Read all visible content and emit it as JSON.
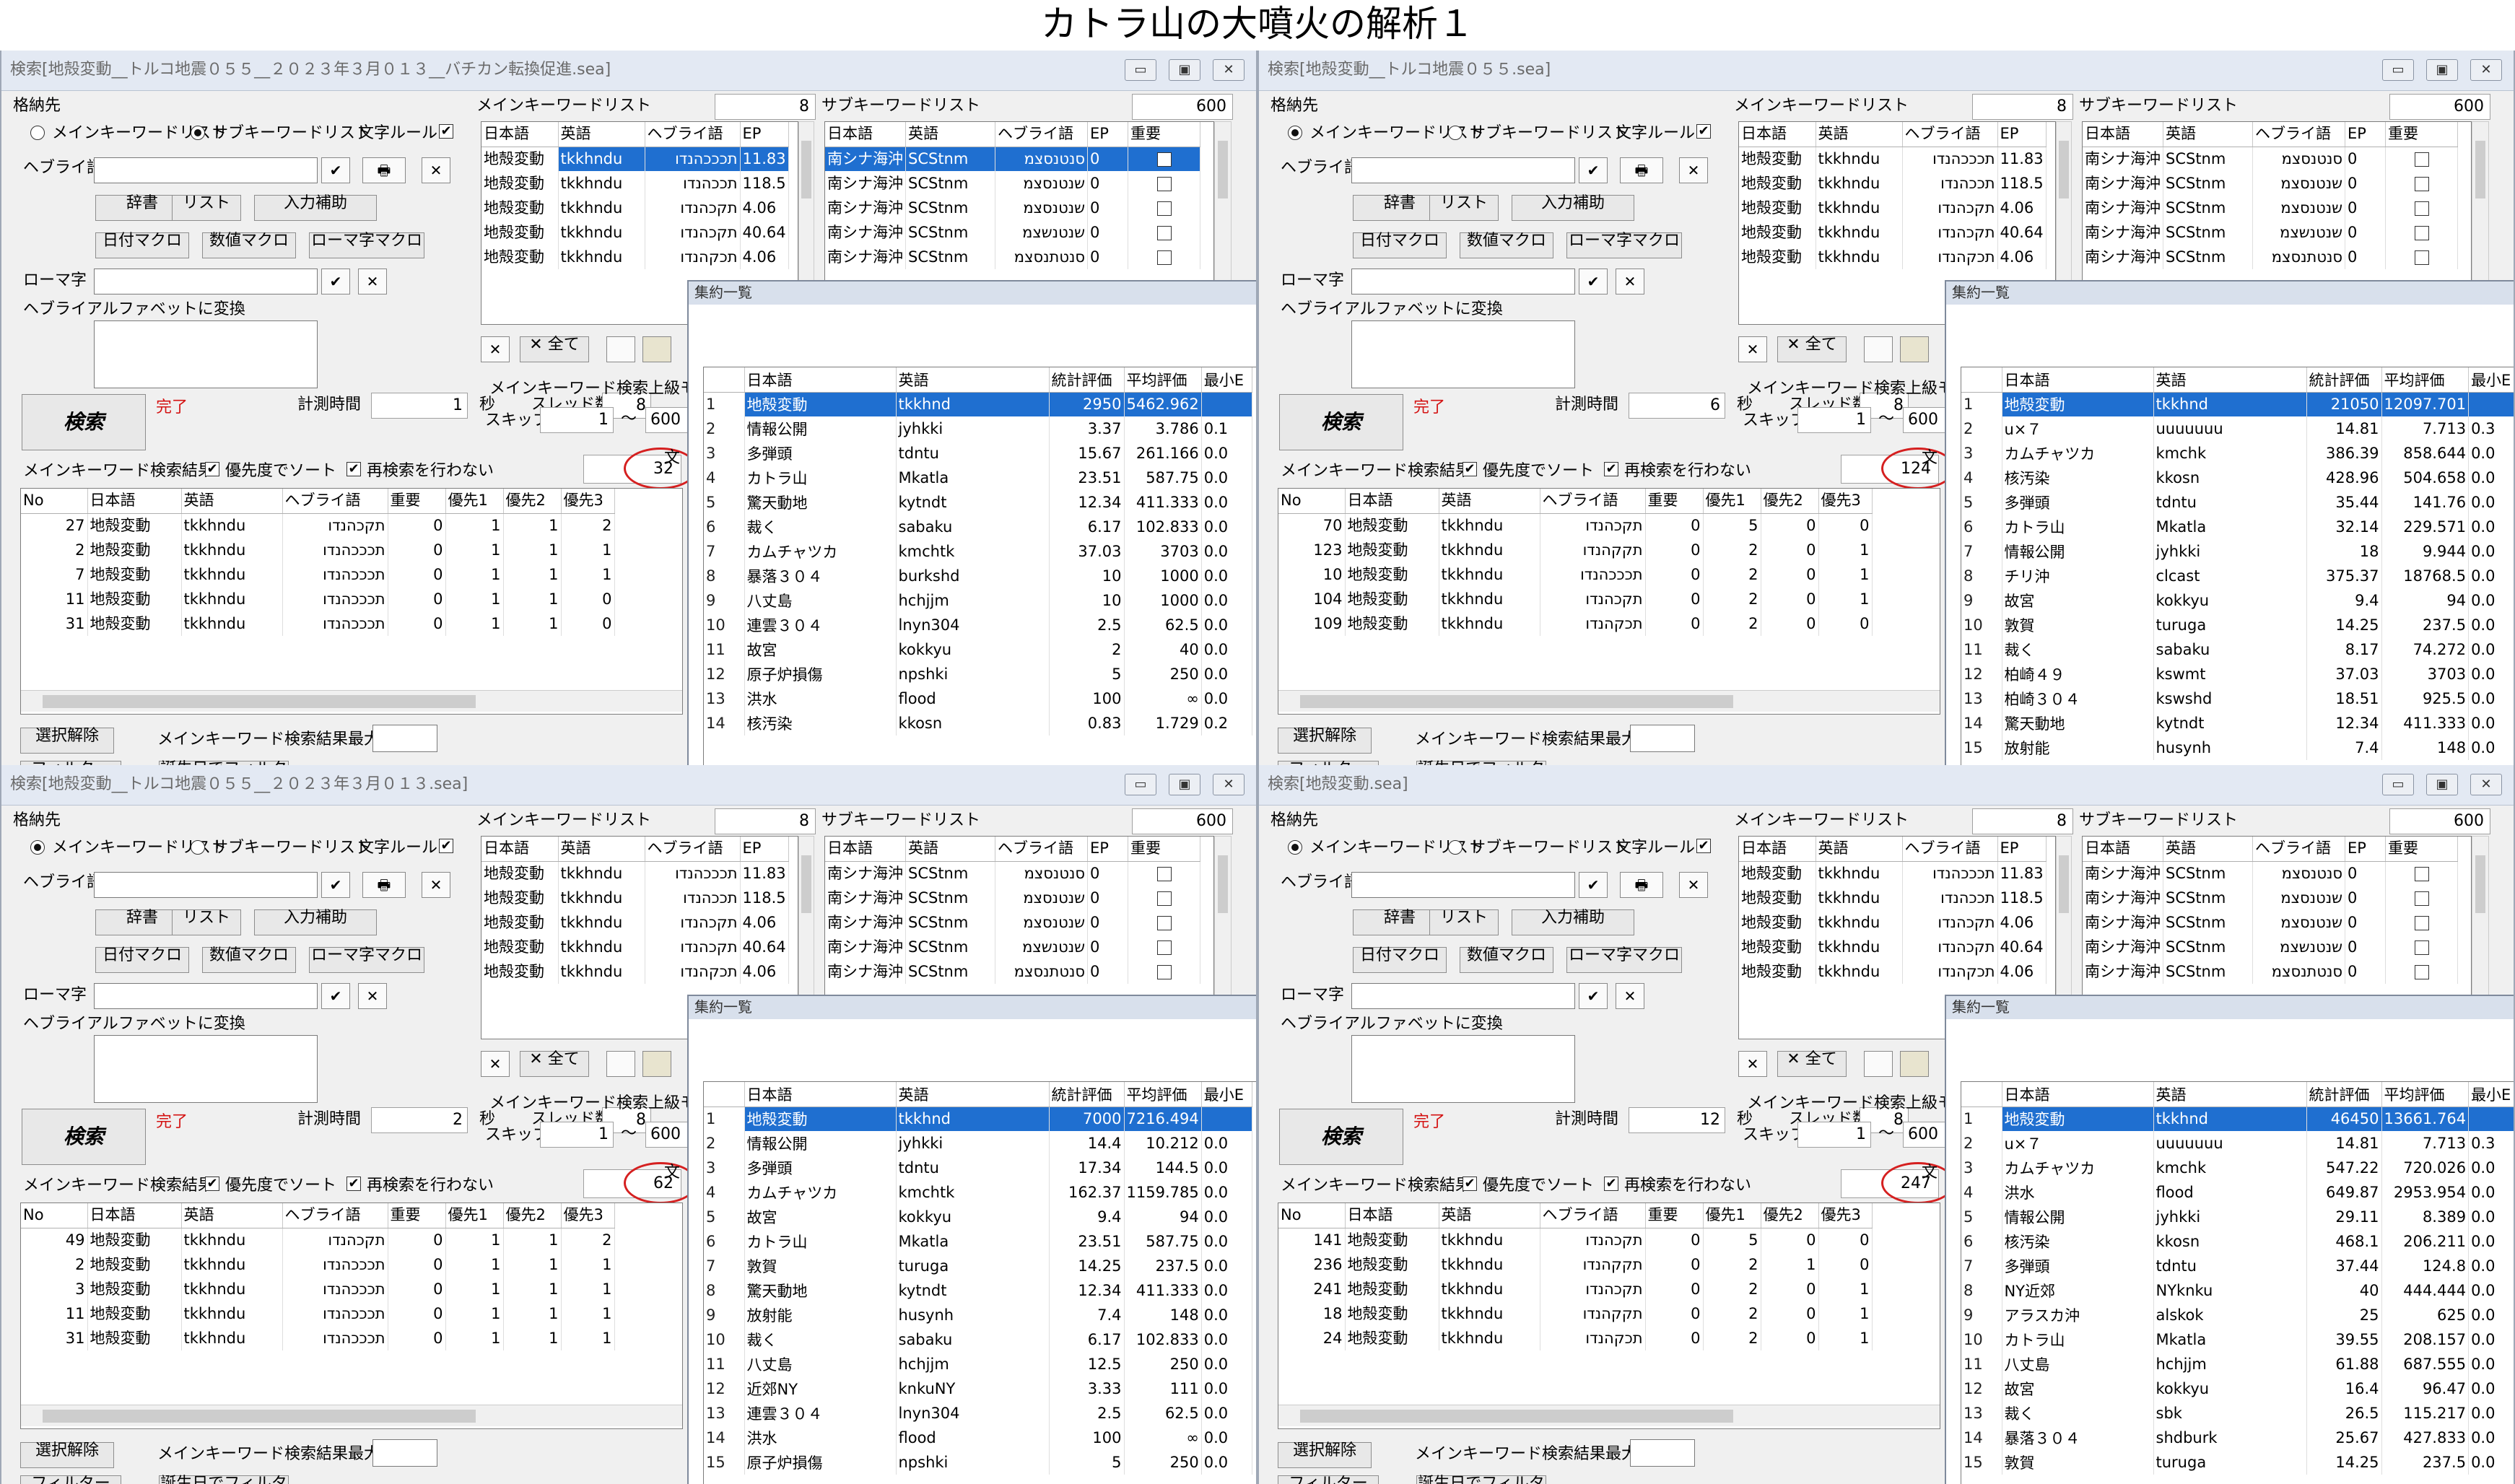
{
  "title": "カトラ山の大噴火の解析１",
  "windows": [
    {
      "title": "検索[地殻変動__トルコ地震０５５__２０２３年３月０１３__バチカン転換促進.sea]",
      "store_main": false,
      "measure_time": "1",
      "result_count": "32",
      "main_results": [
        {
          "no": "27",
          "ja": "地殻変動",
          "en": "tkkhndu",
          "he": "תקכהנדו",
          "imp": "0",
          "p1": "1",
          "p2": "1",
          "p3": "2"
        },
        {
          "no": "2",
          "ja": "地殻変動",
          "en": "tkkhndu",
          "he": "תכככהנדו",
          "imp": "0",
          "p1": "1",
          "p2": "1",
          "p3": "1"
        },
        {
          "no": "7",
          "ja": "地殻変動",
          "en": "tkkhndu",
          "he": "תכככהנדו",
          "imp": "0",
          "p1": "1",
          "p2": "1",
          "p3": "1"
        },
        {
          "no": "11",
          "ja": "地殻変動",
          "en": "tkkhndu",
          "he": "תכככהנדו",
          "imp": "0",
          "p1": "1",
          "p2": "1",
          "p3": "0"
        },
        {
          "no": "31",
          "ja": "地殻変動",
          "en": "tkkhndu",
          "he": "תכככהנדו",
          "imp": "0",
          "p1": "1",
          "p2": "1",
          "p3": "0"
        }
      ],
      "aggregate": [
        {
          "ja": "地殻変動",
          "en": "tkkhnd",
          "stat": "2950",
          "avg": "5462.962",
          "min": ""
        },
        {
          "ja": "情報公開",
          "en": "jyhkki",
          "stat": "3.37",
          "avg": "3.786",
          "min": "0.1"
        },
        {
          "ja": "多弾頭",
          "en": "tdntu",
          "stat": "15.67",
          "avg": "261.166",
          "min": "0.0"
        },
        {
          "ja": "カトラ山",
          "en": "Mkatla",
          "stat": "23.51",
          "avg": "587.75",
          "min": "0.0"
        },
        {
          "ja": "驚天動地",
          "en": "kytndt",
          "stat": "12.34",
          "avg": "411.333",
          "min": "0.0"
        },
        {
          "ja": "裁く",
          "en": "sabaku",
          "stat": "6.17",
          "avg": "102.833",
          "min": "0.0"
        },
        {
          "ja": "カムチャツカ",
          "en": "kmchtk",
          "stat": "37.03",
          "avg": "3703",
          "min": "0.0"
        },
        {
          "ja": "暴落３０４",
          "en": "burkshd",
          "stat": "10",
          "avg": "1000",
          "min": "0.0"
        },
        {
          "ja": "八丈島",
          "en": "hchjjm",
          "stat": "10",
          "avg": "1000",
          "min": "0.0"
        },
        {
          "ja": "連雲３０４",
          "en": "lnyn304",
          "stat": "2.5",
          "avg": "62.5",
          "min": "0.0"
        },
        {
          "ja": "故宮",
          "en": "kokkyu",
          "stat": "2",
          "avg": "40",
          "min": "0.0"
        },
        {
          "ja": "原子炉損傷",
          "en": "npshki",
          "stat": "5",
          "avg": "250",
          "min": "0.0"
        },
        {
          "ja": "洪水",
          "en": "flood",
          "stat": "100",
          "avg": "∞",
          "min": "0.0"
        },
        {
          "ja": "核汚染",
          "en": "kkosn",
          "stat": "0.83",
          "avg": "1.729",
          "min": "0.2"
        }
      ]
    },
    {
      "title": "検索[地殻変動__トルコ地震０５５.sea]",
      "store_main": true,
      "measure_time": "6",
      "result_count": "124",
      "main_results": [
        {
          "no": "70",
          "ja": "地殻変動",
          "en": "tkkhndu",
          "he": "תקכהנדו",
          "imp": "0",
          "p1": "5",
          "p2": "0",
          "p3": "0"
        },
        {
          "no": "123",
          "ja": "地殻変動",
          "en": "tkkhndu",
          "he": "תקקהנדו",
          "imp": "0",
          "p1": "2",
          "p2": "0",
          "p3": "1"
        },
        {
          "no": "10",
          "ja": "地殻変動",
          "en": "tkkhndu",
          "he": "תכככהנדו",
          "imp": "0",
          "p1": "2",
          "p2": "0",
          "p3": "1"
        },
        {
          "no": "104",
          "ja": "地殻変動",
          "en": "tkkhndu",
          "he": "תקכהנדו",
          "imp": "0",
          "p1": "2",
          "p2": "0",
          "p3": "1"
        },
        {
          "no": "109",
          "ja": "地殻変動",
          "en": "tkkhndu",
          "he": "תכקהנדו",
          "imp": "0",
          "p1": "2",
          "p2": "0",
          "p3": "0"
        }
      ],
      "aggregate": [
        {
          "ja": "地殻変動",
          "en": "tkkhnd",
          "stat": "21050",
          "avg": "12097.701",
          "min": ""
        },
        {
          "ja": "u×７",
          "en": "uuuuuuu",
          "stat": "14.81",
          "avg": "7.713",
          "min": "0.3"
        },
        {
          "ja": "カムチャツカ",
          "en": "kmchk",
          "stat": "386.39",
          "avg": "858.644",
          "min": "0.0"
        },
        {
          "ja": "核汚染",
          "en": "kkosn",
          "stat": "428.96",
          "avg": "504.658",
          "min": "0.0"
        },
        {
          "ja": "多弾頭",
          "en": "tdntu",
          "stat": "35.44",
          "avg": "141.76",
          "min": "0.0"
        },
        {
          "ja": "カトラ山",
          "en": "Mkatla",
          "stat": "32.14",
          "avg": "229.571",
          "min": "0.0"
        },
        {
          "ja": "情報公開",
          "en": "jyhkki",
          "stat": "18",
          "avg": "9.944",
          "min": "0.0"
        },
        {
          "ja": "チリ沖",
          "en": "clcast",
          "stat": "375.37",
          "avg": "18768.5",
          "min": "0.0"
        },
        {
          "ja": "故宮",
          "en": "kokkyu",
          "stat": "9.4",
          "avg": "94",
          "min": "0.0"
        },
        {
          "ja": "敦賀",
          "en": "turuga",
          "stat": "14.25",
          "avg": "237.5",
          "min": "0.0"
        },
        {
          "ja": "裁く",
          "en": "sabaku",
          "stat": "8.17",
          "avg": "74.272",
          "min": "0.0"
        },
        {
          "ja": "柏崎４９",
          "en": "kswmt",
          "stat": "37.03",
          "avg": "3703",
          "min": "0.0"
        },
        {
          "ja": "柏崎３０４",
          "en": "kswshd",
          "stat": "18.51",
          "avg": "925.5",
          "min": "0.0"
        },
        {
          "ja": "驚天動地",
          "en": "kytndt",
          "stat": "12.34",
          "avg": "411.333",
          "min": "0.0"
        },
        {
          "ja": "放射能",
          "en": "husynh",
          "stat": "7.4",
          "avg": "148",
          "min": "0.0"
        }
      ]
    },
    {
      "title": "検索[地殻変動__トルコ地震０５５__２０２３年３月０１３.sea]",
      "store_main": true,
      "measure_time": "2",
      "result_count": "62",
      "main_results": [
        {
          "no": "49",
          "ja": "地殻変動",
          "en": "tkkhndu",
          "he": "תקכהנדו",
          "imp": "0",
          "p1": "1",
          "p2": "1",
          "p3": "2"
        },
        {
          "no": "2",
          "ja": "地殻変動",
          "en": "tkkhndu",
          "he": "תכככהנדו",
          "imp": "0",
          "p1": "1",
          "p2": "1",
          "p3": "1"
        },
        {
          "no": "3",
          "ja": "地殻変動",
          "en": "tkkhndu",
          "he": "תכככהנדו",
          "imp": "0",
          "p1": "1",
          "p2": "1",
          "p3": "1"
        },
        {
          "no": "11",
          "ja": "地殻変動",
          "en": "tkkhndu",
          "he": "תכככהנדו",
          "imp": "0",
          "p1": "1",
          "p2": "1",
          "p3": "1"
        },
        {
          "no": "31",
          "ja": "地殻変動",
          "en": "tkkhndu",
          "he": "תכככהנדו",
          "imp": "0",
          "p1": "1",
          "p2": "1",
          "p3": "1"
        }
      ],
      "aggregate": [
        {
          "ja": "地殻変動",
          "en": "tkkhnd",
          "stat": "7000",
          "avg": "7216.494",
          "min": ""
        },
        {
          "ja": "情報公開",
          "en": "jyhkki",
          "stat": "14.4",
          "avg": "10.212",
          "min": "0.0"
        },
        {
          "ja": "多弾頭",
          "en": "tdntu",
          "stat": "17.34",
          "avg": "144.5",
          "min": "0.0"
        },
        {
          "ja": "カムチャツカ",
          "en": "kmchtk",
          "stat": "162.37",
          "avg": "1159.785",
          "min": "0.0"
        },
        {
          "ja": "故宮",
          "en": "kokkyu",
          "stat": "9.4",
          "avg": "94",
          "min": "0.0"
        },
        {
          "ja": "カトラ山",
          "en": "Mkatla",
          "stat": "23.51",
          "avg": "587.75",
          "min": "0.0"
        },
        {
          "ja": "敦賀",
          "en": "turuga",
          "stat": "14.25",
          "avg": "237.5",
          "min": "0.0"
        },
        {
          "ja": "驚天動地",
          "en": "kytndt",
          "stat": "12.34",
          "avg": "411.333",
          "min": "0.0"
        },
        {
          "ja": "放射能",
          "en": "husynh",
          "stat": "7.4",
          "avg": "148",
          "min": "0.0"
        },
        {
          "ja": "裁く",
          "en": "sabaku",
          "stat": "6.17",
          "avg": "102.833",
          "min": "0.0"
        },
        {
          "ja": "八丈島",
          "en": "hchjjm",
          "stat": "12.5",
          "avg": "250",
          "min": "0.0"
        },
        {
          "ja": "近郊NY",
          "en": "knkuNY",
          "stat": "3.33",
          "avg": "111",
          "min": "0.0"
        },
        {
          "ja": "連雲３０４",
          "en": "lnyn304",
          "stat": "2.5",
          "avg": "62.5",
          "min": "0.0"
        },
        {
          "ja": "洪水",
          "en": "flood",
          "stat": "100",
          "avg": "∞",
          "min": "0.0"
        },
        {
          "ja": "原子炉損傷",
          "en": "npshki",
          "stat": "5",
          "avg": "250",
          "min": "0.0"
        }
      ]
    },
    {
      "title": "検索[地殻変動.sea]",
      "store_main": true,
      "measure_time": "12",
      "result_count": "247",
      "main_results": [
        {
          "no": "141",
          "ja": "地殻変動",
          "en": "tkkhndu",
          "he": "תקכהנדו",
          "imp": "0",
          "p1": "5",
          "p2": "0",
          "p3": "0"
        },
        {
          "no": "236",
          "ja": "地殻変動",
          "en": "tkkhndu",
          "he": "תקקהנדו",
          "imp": "0",
          "p1": "2",
          "p2": "1",
          "p3": "0"
        },
        {
          "no": "241",
          "ja": "地殻変動",
          "en": "tkkhndu",
          "he": "תקכהנדו",
          "imp": "0",
          "p1": "2",
          "p2": "0",
          "p3": "1"
        },
        {
          "no": "18",
          "ja": "地殻変動",
          "en": "tkkhndu",
          "he": "תקקהנדו",
          "imp": "0",
          "p1": "2",
          "p2": "0",
          "p3": "1"
        },
        {
          "no": "24",
          "ja": "地殻変動",
          "en": "tkkhndu",
          "he": "תכקהנדו",
          "imp": "0",
          "p1": "2",
          "p2": "0",
          "p3": "1"
        }
      ],
      "aggregate": [
        {
          "ja": "地殻変動",
          "en": "tkkhnd",
          "stat": "46450",
          "avg": "13661.764",
          "min": ""
        },
        {
          "ja": "u×７",
          "en": "uuuuuuu",
          "stat": "14.81",
          "avg": "7.713",
          "min": "0.3"
        },
        {
          "ja": "カムチャツカ",
          "en": "kmchk",
          "stat": "547.22",
          "avg": "720.026",
          "min": "0.0"
        },
        {
          "ja": "洪水",
          "en": "flood",
          "stat": "649.87",
          "avg": "2953.954",
          "min": "0.0"
        },
        {
          "ja": "情報公開",
          "en": "jyhkki",
          "stat": "29.11",
          "avg": "8.389",
          "min": "0.0"
        },
        {
          "ja": "核汚染",
          "en": "kkosn",
          "stat": "468.1",
          "avg": "206.211",
          "min": "0.0"
        },
        {
          "ja": "多弾頭",
          "en": "tdntu",
          "stat": "37.44",
          "avg": "124.8",
          "min": "0.0"
        },
        {
          "ja": "NY近郊",
          "en": "NYknku",
          "stat": "40",
          "avg": "444.444",
          "min": "0.0"
        },
        {
          "ja": "アラスカ沖",
          "en": "alskok",
          "stat": "25",
          "avg": "625",
          "min": "0.0"
        },
        {
          "ja": "カトラ山",
          "en": "Mkatla",
          "stat": "39.55",
          "avg": "208.157",
          "min": "0.0"
        },
        {
          "ja": "八丈島",
          "en": "hchjjm",
          "stat": "61.88",
          "avg": "687.555",
          "min": "0.0"
        },
        {
          "ja": "故宮",
          "en": "kokkyu",
          "stat": "16.4",
          "avg": "96.47",
          "min": "0.0"
        },
        {
          "ja": "裁く",
          "en": "sbk",
          "stat": "26.5",
          "avg": "115.217",
          "min": "0.0"
        },
        {
          "ja": "暴落３０４",
          "en": "shdburk",
          "stat": "25.67",
          "avg": "427.833",
          "min": "0.0"
        },
        {
          "ja": "敦賀",
          "en": "turuga",
          "stat": "14.25",
          "avg": "237.5",
          "min": "0.0"
        }
      ]
    }
  ],
  "labels": {
    "store": "格納先",
    "main_kw_list": "メインキーワードリスト",
    "sub_kw_list": "サブキーワードリスト",
    "char_rule": "文字ルール",
    "hebrew": "ヘブライ語",
    "dictionary": "辞書",
    "list": "リスト",
    "input_assist": "入力補助",
    "date_macro": "日付マクロ",
    "num_macro": "数値マクロ",
    "roman_macro": "ローマ字マクロ",
    "romaji": "ローマ字",
    "hebrew_convert": "ヘブライアルファベットに変換",
    "search": "検索",
    "done": "完了",
    "measure_time": "計測時間",
    "seconds": "秒",
    "threads": "スレッド数",
    "thread_count": "8",
    "main_count": "8",
    "sub_count": "600",
    "main_results_label": "メインキーワード検索結果",
    "sort_priority": "優先度でソート",
    "no_research": "再検索を行わない",
    "deselect": "選択解除",
    "max_results": "メインキーワード検索結果最大数",
    "filter": "フィルター",
    "birthday_filter": "誕生日でフィルタ",
    "advanced_mode": "メインキーワード検索上級モード",
    "skip": "スキップ",
    "skip_from": "1",
    "skip_sep": "～",
    "skip_to": "600",
    "all": "全て",
    "aggregate_title": "集約一覧",
    "sub_flag": "文"
  },
  "headers": {
    "kw": [
      "日本語",
      "英語",
      "ヘブライ語",
      "EP"
    ],
    "sub": [
      "日本語",
      "英語",
      "ヘブライ語",
      "EP",
      "重要"
    ],
    "results": [
      "No",
      "日本語",
      "英語",
      "ヘブライ語",
      "重要",
      "優先1",
      "優先2",
      "優先3"
    ],
    "aggregate": [
      "日本語",
      "英語",
      "統計評価",
      "平均評価",
      "最小E"
    ]
  },
  "main_kw": [
    {
      "ja": "地殻変動",
      "en": "tkkhndu",
      "he": "תכככהנדו",
      "ep": "11.83"
    },
    {
      "ja": "地殻変動",
      "en": "tkkhndu",
      "he": "תככהנדו",
      "ep": "118.5"
    },
    {
      "ja": "地殻変動",
      "en": "tkkhndu",
      "he": "תקכהנדו",
      "ep": "4.06"
    },
    {
      "ja": "地殻変動",
      "en": "tkkhndu",
      "he": "תקכהנדו",
      "ep": "40.64"
    },
    {
      "ja": "地殻変動",
      "en": "tkkhndu",
      "he": "תכקהנדו",
      "ep": "4.06"
    }
  ],
  "sub_kw": [
    {
      "ja": "南シナ海沖",
      "en": "SCStnm",
      "he": "סנטנסצמ",
      "ep": "0"
    },
    {
      "ja": "南シナ海沖",
      "en": "SCStnm",
      "he": "שנטנסצמ",
      "ep": "0"
    },
    {
      "ja": "南シナ海沖",
      "en": "SCStnm",
      "he": "שנטנסצמ",
      "ep": "0"
    },
    {
      "ja": "南シナ海沖",
      "en": "SCStnm",
      "he": "שנטנשצמ",
      "ep": "0"
    },
    {
      "ja": "南シナ海沖",
      "en": "SCStnm",
      "he": "סנטתנסצמ",
      "ep": "0"
    }
  ],
  "radio": {
    "main": "メインキーワードリスト",
    "sub": "サブキーワードリスト"
  },
  "icons": {
    "check": "✔",
    "print": "🖶",
    "close": "✕",
    "xmark": "✕"
  }
}
